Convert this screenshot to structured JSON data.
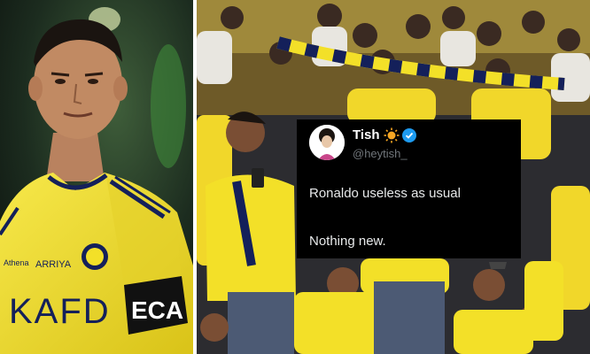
{
  "tweet": {
    "display_name": "Tish",
    "handle": "@heytish_",
    "lines": [
      "Ronaldo useless as usual",
      "Nothing new."
    ],
    "badges": [
      "sun-emoji-icon",
      "verified-badge-icon"
    ]
  },
  "left_photo": {
    "jersey_text": [
      "KAFD",
      "ARRIYA",
      "Athena"
    ]
  },
  "colors": {
    "jersey_yellow": "#f3e028",
    "navy": "#14205a",
    "tweet_bg": "#000000",
    "verified_blue": "#1d9bf0"
  }
}
